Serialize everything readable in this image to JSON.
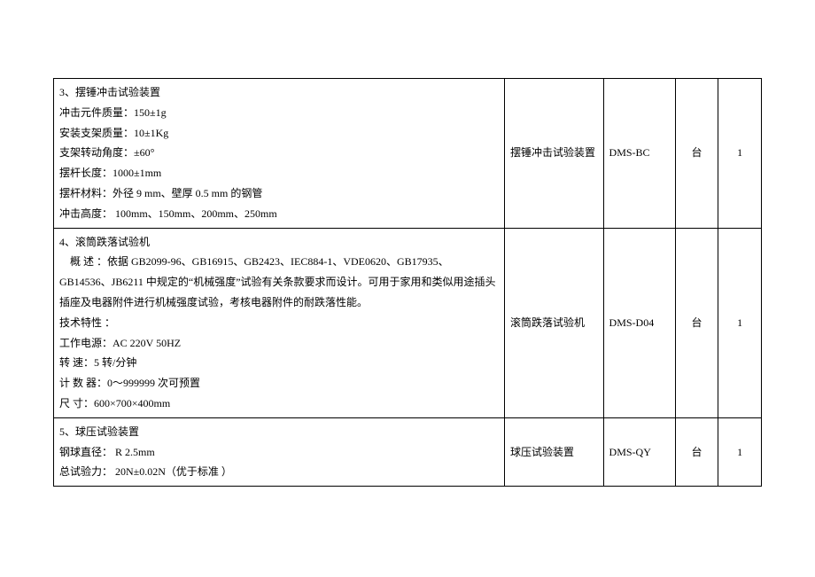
{
  "rows": [
    {
      "desc_lines": [
        "3、摆锤冲击试验装置",
        "冲击元件质量：150±1g",
        "安装支架质量：10±1Kg",
        "支架转动角度：±60°",
        "摆杆长度：1000±1mm",
        "摆杆材料：外径 9 mm、壁厚 0.5 mm 的钢管",
        "冲击高度： 100mm、150mm、200mm、250mm"
      ],
      "name": "摆锤冲击试验装置",
      "model": "DMS-BC",
      "unit": "台",
      "qty": "1"
    },
    {
      "desc_lines": [
        "4、滚筒跌落试验机",
        "    概 述 ：依据 GB2099-96、GB16915、GB2423、IEC884-1、VDE0620、GB17935、GB14536、JB6211 中规定的“机械强度”试验有关条款要求而设计。可用于家用和类似用途插头插座及电器附件进行机械强度试验，考核电器附件的耐跌落性能。",
        "技术特性 ：",
        "工作电源：AC 220V 50HZ",
        "转 速：5 转/分钟",
        "计 数 器：0～999999 次可预置",
        "尺 寸：600×700×400mm"
      ],
      "name": "滚筒跌落试验机",
      "model": "DMS-D04",
      "unit": "台",
      "qty": "1"
    },
    {
      "desc_lines": [
        "5、球压试验装置",
        "钢球直径： R 2.5mm",
        "总试验力： 20N±0.02N（优于标准 ）"
      ],
      "name": "球压试验装置",
      "model": "DMS-QY",
      "unit": "台",
      "qty": "1"
    }
  ]
}
